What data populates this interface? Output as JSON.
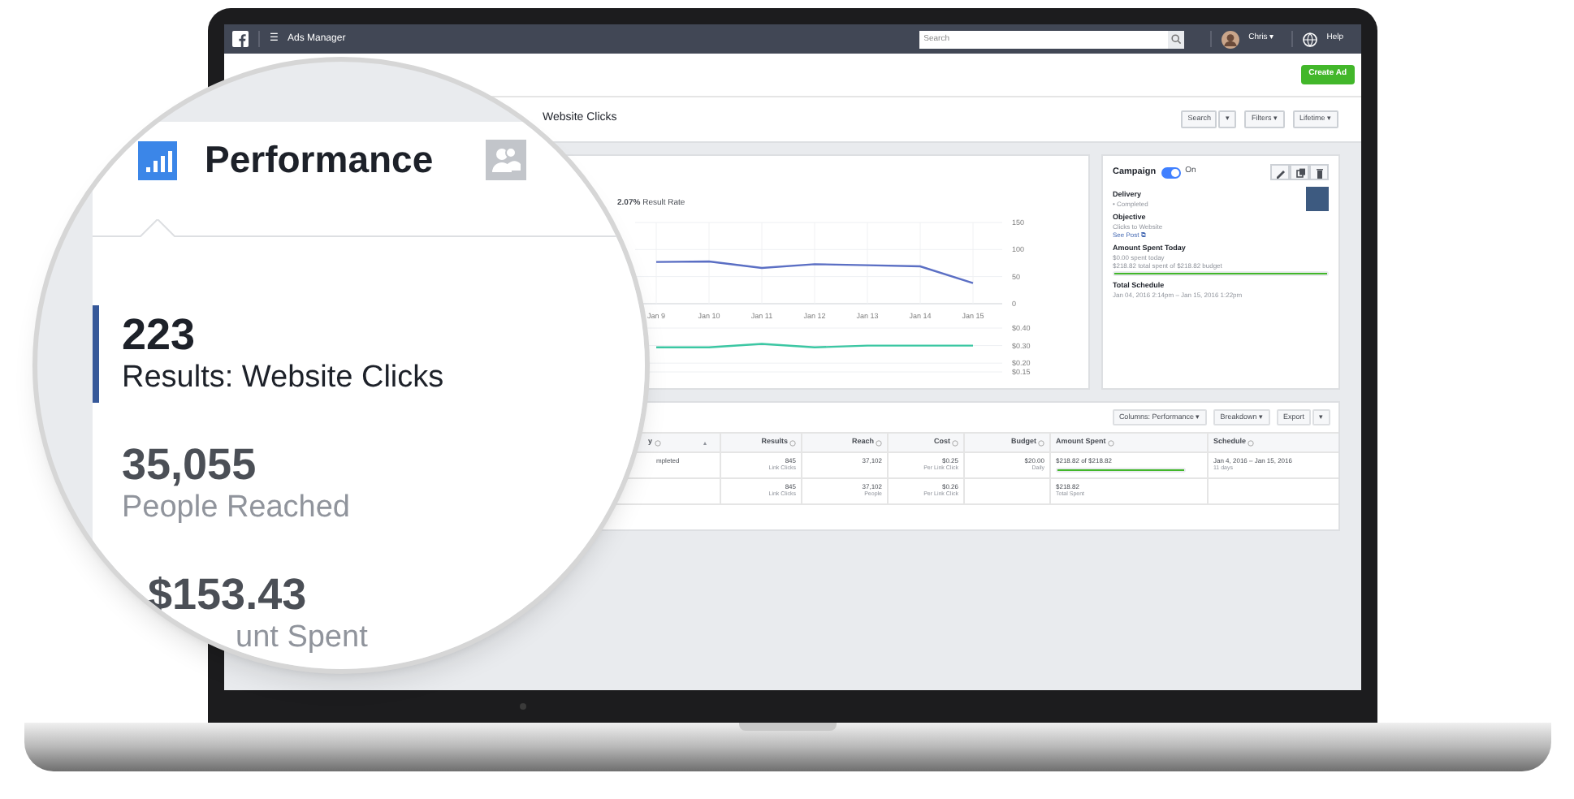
{
  "header": {
    "app_name": "Ads Manager",
    "menu_glyph": "☰",
    "search": {
      "placeholder": "Search"
    },
    "user": "Chris ▾",
    "help": "Help"
  },
  "toolbar": {
    "create_button": "Create Ad"
  },
  "title_row": {
    "title": "Website Clicks",
    "buttons": [
      "Search",
      "▾",
      "Filters ▾",
      "Lifetime ▾"
    ]
  },
  "chart_panel": {
    "headline": "**2.07%** Result Rate",
    "chart_data": {
      "type": "line",
      "grid": true,
      "categories": [
        "Jan 9",
        "Jan 10",
        "Jan 11",
        "Jan 12",
        "Jan 13",
        "Jan 14",
        "Jan 15"
      ],
      "yticks": [
        0,
        50,
        100,
        150
      ],
      "ylim": [
        0,
        150
      ],
      "series": [
        {
          "color": "#5b6fc4",
          "values": [
            77,
            78,
            66,
            73,
            71,
            69,
            38
          ]
        }
      ]
    },
    "cost_chart": {
      "chart_data": {
        "type": "line",
        "grid": true,
        "yticks": [
          {
            "value": 0.15,
            "label": "$0.15"
          },
          {
            "value": 0.2,
            "label": "$0.20"
          },
          {
            "value": 0.3,
            "label": "$0.30"
          },
          {
            "value": 0.4,
            "label": "$0.40"
          }
        ],
        "ylim": [
          0.15,
          0.4
        ],
        "series": [
          {
            "color": "#3cc7a3",
            "values": [
              0.29,
              0.29,
              0.31,
              0.29,
              0.3,
              0.3,
              0.3
            ]
          }
        ]
      }
    }
  },
  "campaign_panel": {
    "title": "Campaign",
    "toggle": {
      "on": true,
      "label": "On"
    },
    "actions": [
      {
        "kind": "pencil"
      },
      {
        "kind": "copy"
      },
      {
        "kind": "trash"
      }
    ],
    "sections": [
      {
        "heading": "Delivery",
        "lines": [
          {
            "text": "• Completed",
            "kind": "plain"
          }
        ]
      },
      {
        "heading": "Objective",
        "lines": [
          {
            "text": "Clicks to Website",
            "kind": "plain"
          },
          {
            "text": "See Post ⧉",
            "kind": "link"
          }
        ]
      },
      {
        "heading": "Amount Spent Today",
        "lines": [
          {
            "text": "$0.00 spent today",
            "kind": "plain"
          },
          {
            "text": "$218.82 total spent of $218.82 budget",
            "kind": "plain"
          }
        ],
        "level": 1
      },
      {
        "heading": "Total Schedule",
        "lines": [
          {
            "text": "Jan 04, 2016 2:14pm – Jan 15, 2016 1:22pm",
            "kind": "plain"
          }
        ]
      }
    ]
  },
  "table": {
    "toolbar": [
      "Columns: Performance ▾",
      "Breakdown ▾",
      "Export",
      "▾"
    ],
    "columns": [
      {
        "label": "y",
        "sort": "▴"
      },
      {
        "label": "Results"
      },
      {
        "label": "Reach"
      },
      {
        "label": "Cost"
      },
      {
        "label": "Budget"
      },
      {
        "label": "Amount Spent"
      },
      {
        "label": "Schedule"
      }
    ],
    "rows": [
      {
        "cells": [
          {
            "main": "mpleted"
          },
          {
            "main": "845",
            "sub": "Link Clicks"
          },
          {
            "main": "37,102"
          },
          {
            "main": "$0.25",
            "sub": "Per Link Click"
          },
          {
            "main": "$20.00",
            "sub": "Daily"
          },
          {
            "main": "$218.82 of $218.82",
            "level": 1
          },
          {
            "main": "Jan 4, 2016 – Jan 15, 2016",
            "sub": "11 days"
          }
        ]
      },
      {
        "cells": [
          {},
          {
            "main": "845",
            "sub": "Link Clicks"
          },
          {
            "main": "37,102",
            "sub": "People"
          },
          {
            "main": "$0.26",
            "sub": "Per Link Click"
          },
          {},
          {
            "main": "$218.82",
            "sub": "Total Spent"
          },
          {}
        ]
      }
    ]
  },
  "magnifier": {
    "tabs": [
      {
        "kind": "chart",
        "label": "Performance",
        "selected": true
      },
      {
        "kind": "people",
        "selected": false
      }
    ],
    "metrics": [
      {
        "value": "223",
        "label": "Results: Website Clicks",
        "selected": true
      },
      {
        "value": "35,055",
        "label": "People Reached",
        "selected": false
      },
      {
        "value": "$153.43",
        "label": "unt Spent",
        "selected": false
      }
    ]
  }
}
